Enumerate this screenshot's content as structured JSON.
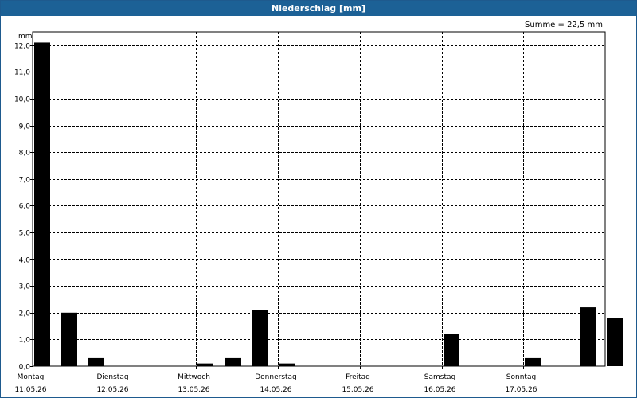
{
  "window": {
    "title": "Niederschlag [mm]"
  },
  "summary": {
    "text": "Summe = 22,5 mm"
  },
  "colors": {
    "titlebar": "#1c6196",
    "bar": "#000000",
    "grid": "#000000"
  },
  "chart_data": {
    "type": "bar",
    "ylabel": "mm",
    "ylim": [
      0,
      12.5
    ],
    "y_ticks": [
      "0,0",
      "1,0",
      "2,0",
      "3,0",
      "4,0",
      "5,0",
      "6,0",
      "7,0",
      "8,0",
      "9,0",
      "10,0",
      "11,0",
      "12,0"
    ],
    "x_days": [
      {
        "day": "Montag",
        "date": "11.05.26"
      },
      {
        "day": "Dienstag",
        "date": "12.05.26"
      },
      {
        "day": "Mittwoch",
        "date": "13.05.26"
      },
      {
        "day": "Donnerstag",
        "date": "14.05.26"
      },
      {
        "day": "Freitag",
        "date": "15.05.26"
      },
      {
        "day": "Samstag",
        "date": "16.05.26"
      },
      {
        "day": "Sonntag",
        "date": "17.05.26"
      }
    ],
    "bars_per_day": 3,
    "values": [
      12.1,
      2.0,
      0.3,
      0,
      0,
      0,
      0.1,
      0.3,
      2.1,
      0.1,
      0,
      0,
      0,
      0,
      0,
      1.2,
      0,
      0,
      0.3,
      0,
      2.2,
      1.8
    ],
    "grid": "dashed"
  }
}
